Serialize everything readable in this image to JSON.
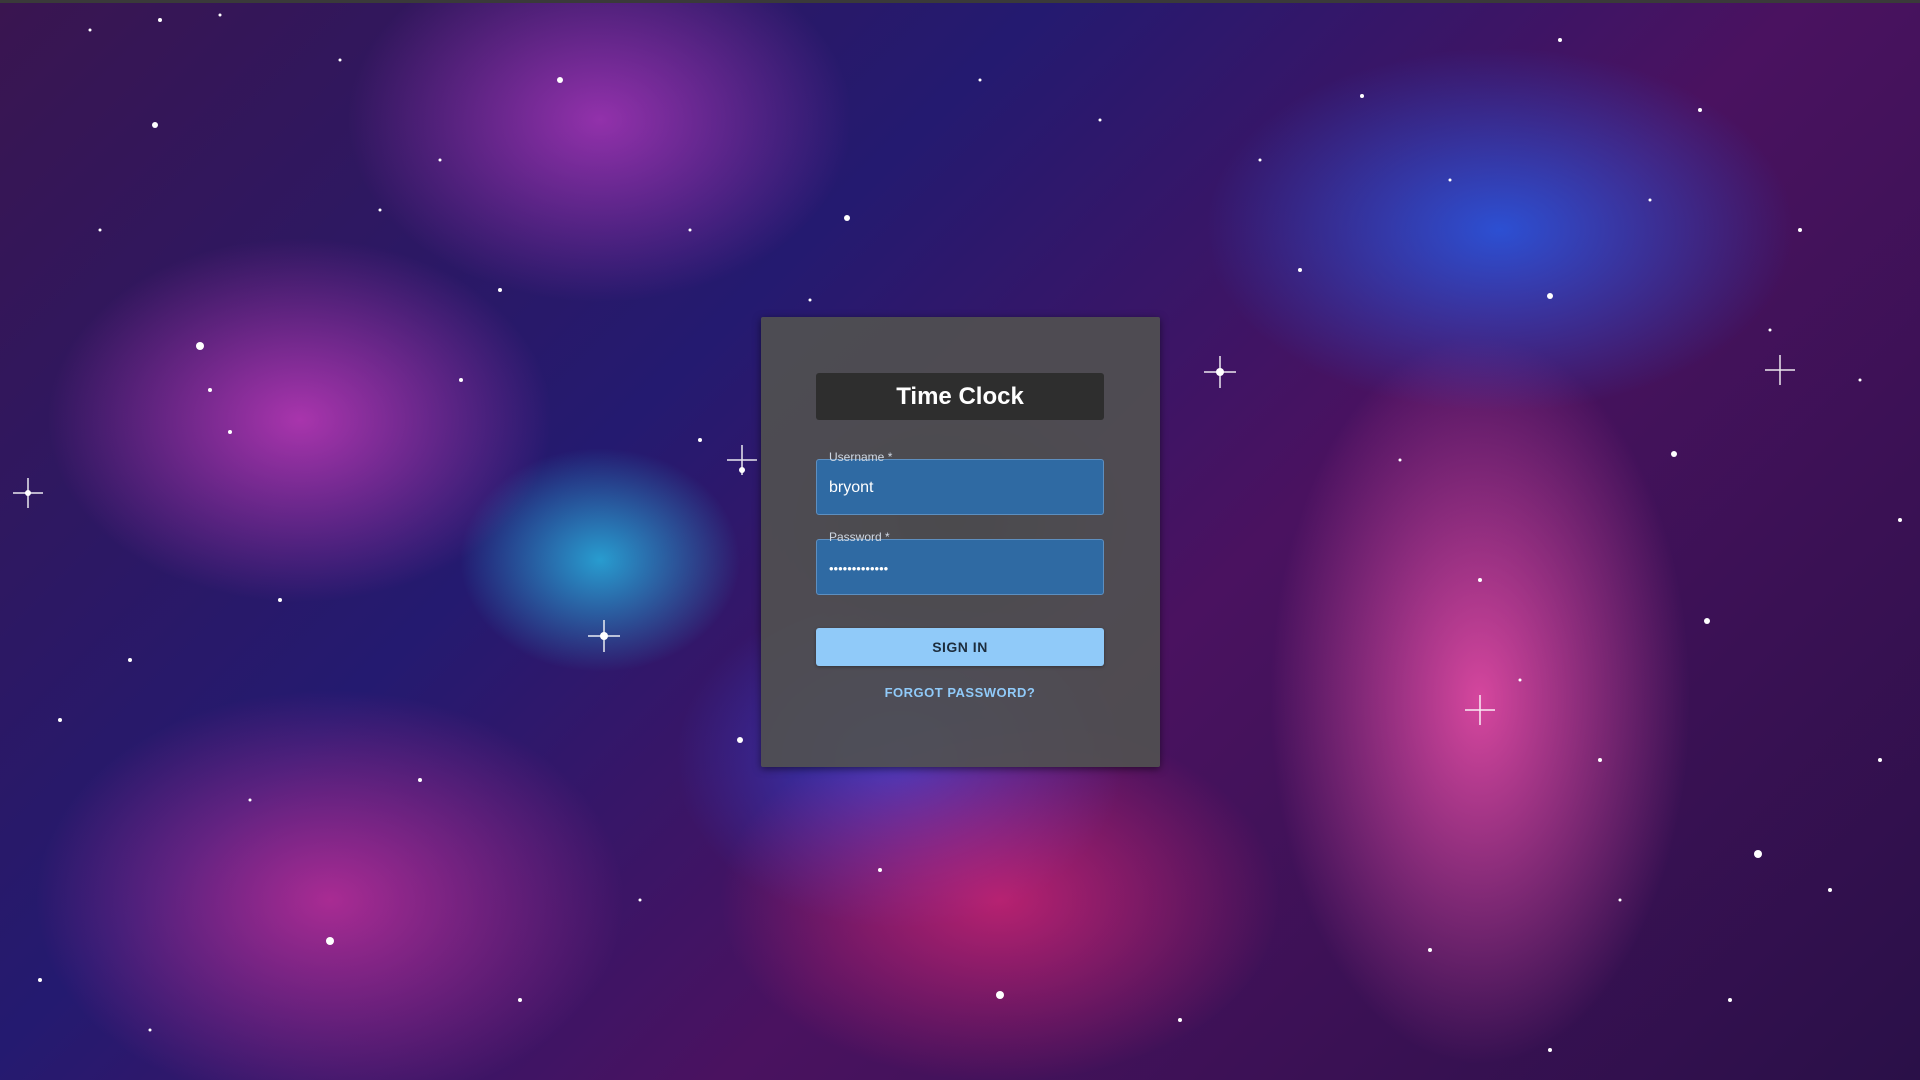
{
  "app": {
    "title": "Time Clock"
  },
  "login": {
    "username_label": "Username *",
    "username_value": "bryont",
    "password_label": "Password *",
    "password_value": "•••••••••••••",
    "sign_in_label": "SIGN IN",
    "forgot_password_label": "FORGOT PASSWORD?"
  },
  "colors": {
    "card_bg": "#505050",
    "title_bg": "#2e2e2e",
    "field_bg": "#2f6aa3",
    "button_bg": "#90caf9",
    "link_color": "#90caf9"
  }
}
